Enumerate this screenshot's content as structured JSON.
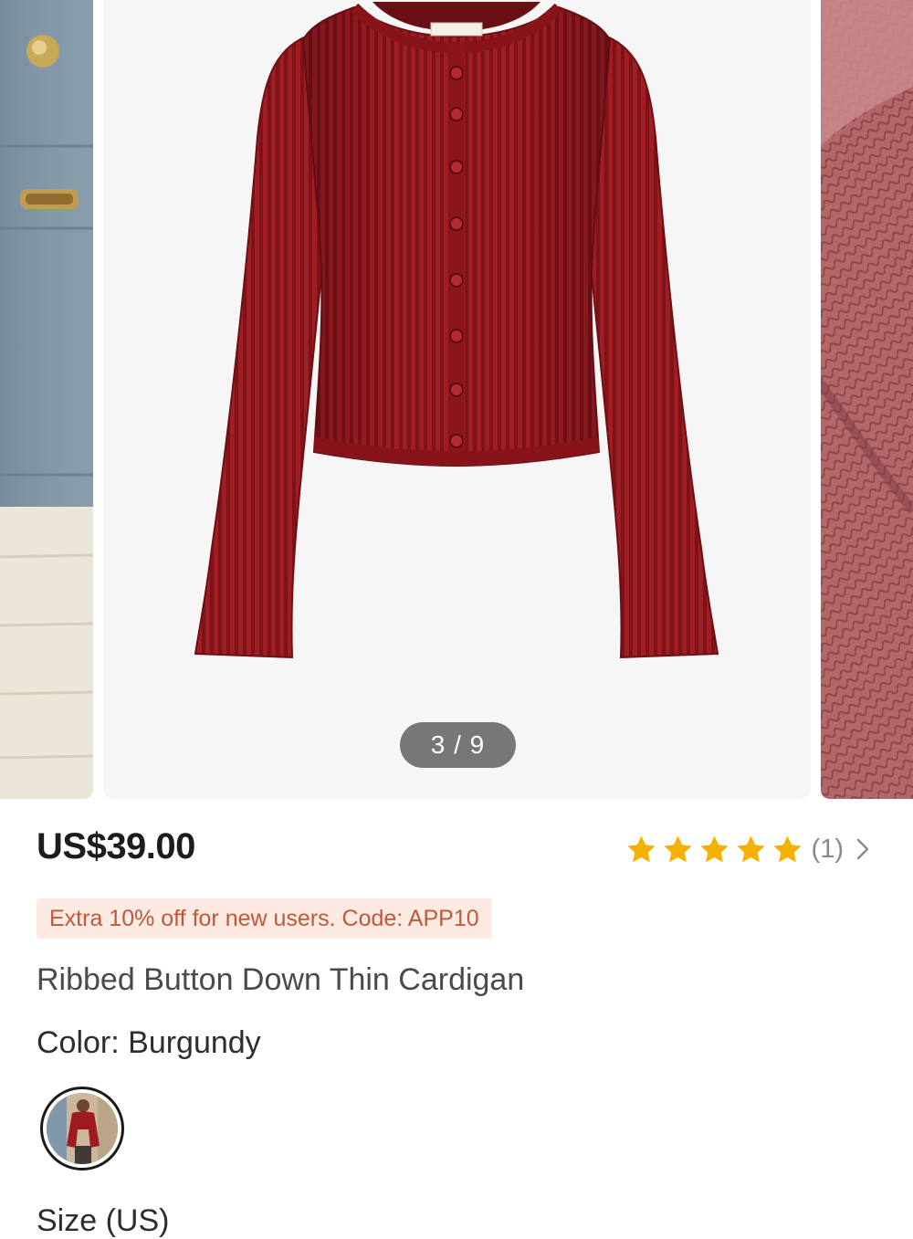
{
  "gallery": {
    "current": 3,
    "total": 9,
    "indicator_text": "3 / 9",
    "main_image": "burgundy-ribbed-cardigan-product-photo",
    "prev_image": "model-wearing-cardigan-by-blue-door",
    "next_image": "ribbed-knit-fabric-closeup"
  },
  "product": {
    "price": "US$39.00",
    "rating": {
      "stars": 5,
      "max_stars": 5,
      "review_count": "(1)",
      "star_icon": "star-icon",
      "star_color": "#f5b000"
    },
    "promo": "Extra 10% off for new users. Code: APP10",
    "title": "Ribbed Button Down Thin Cardigan",
    "color_label": "Color: Burgundy",
    "swatches": [
      {
        "name": "Burgundy",
        "selected": true
      }
    ],
    "size_label": "Size (US)"
  },
  "colors": {
    "garment": "#9e1b22",
    "promo_text": "#c0593a",
    "promo_bg": "#fdeae3"
  }
}
